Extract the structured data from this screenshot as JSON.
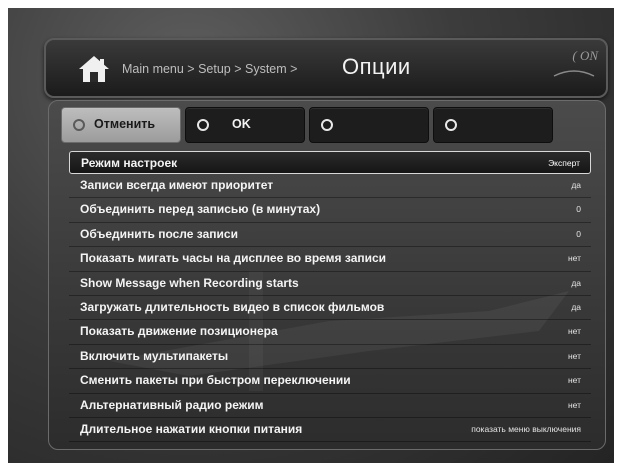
{
  "header": {
    "breadcrumb": "Main menu > Setup > System >",
    "title": "Опции",
    "brand": "( ON"
  },
  "buttons": [
    {
      "label": "Отменить",
      "color": "#b0b0b0"
    },
    {
      "label": "OK",
      "color": "#1d1d1d"
    },
    {
      "label": "",
      "color": "#1d1d1d"
    },
    {
      "label": "",
      "color": "#1d1d1d"
    }
  ],
  "options": [
    {
      "label": "Режим настроек",
      "value": "Эксперт"
    },
    {
      "label": "Записи всегда имеют приоритет",
      "value": "да"
    },
    {
      "label": "Объединить перед записью (в минутах)",
      "value": "0"
    },
    {
      "label": "Объединить после записи",
      "value": "0"
    },
    {
      "label": "Показать мигать часы на дисплее во время записи",
      "value": "нет"
    },
    {
      "label": "Show Message when Recording starts",
      "value": "да"
    },
    {
      "label": "Загружать длительность видео в список фильмов",
      "value": "да"
    },
    {
      "label": "Показать движение позиционера",
      "value": "нет"
    },
    {
      "label": "Включить мультипакеты",
      "value": "нет"
    },
    {
      "label": "Сменить пакеты при быстром переключении",
      "value": "нет"
    },
    {
      "label": "Альтернативный радио режим",
      "value": "нет"
    },
    {
      "label": "Длительное нажатии кнопки питания",
      "value": "показать меню выключения"
    }
  ],
  "selected_index": 0,
  "colors": {
    "background": "#3c3c3c",
    "text": "#f4f4f4",
    "selected_border": "#d8d8d8"
  }
}
